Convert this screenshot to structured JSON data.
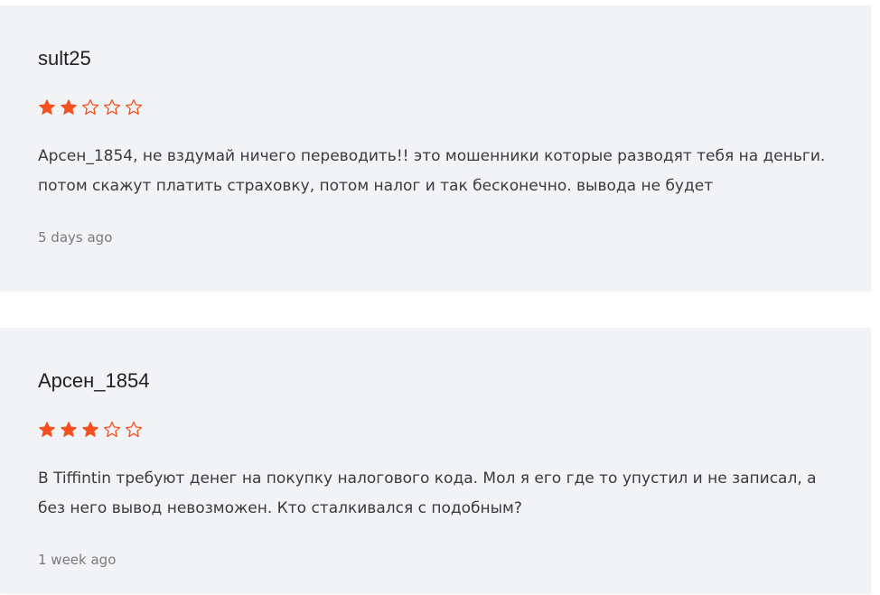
{
  "reviews": [
    {
      "author": "sult25",
      "rating": 2,
      "max_rating": 5,
      "text": "Арсен_1854, не вздумай ничего переводить!! это мошенники которые разводят тебя на деньги. потом скажут платить страховку, потом налог и так бесконечно. вывода не будет",
      "time": "5 days ago"
    },
    {
      "author": "Арсен_1854",
      "rating": 3,
      "max_rating": 5,
      "text": "В Tiffintin требуют денег на покупку налогового кода. Мол я его где то упустил и не записал, а без него вывод невозможен. Кто сталкивался с подобным?",
      "time": "1 week ago"
    }
  ],
  "colors": {
    "star_filled": "#f4511e",
    "star_outline": "#f4511e",
    "card_background": "#f2f3f7"
  },
  "icons": {
    "star_filled": "star-filled-icon",
    "star_empty": "star-outline-icon"
  }
}
